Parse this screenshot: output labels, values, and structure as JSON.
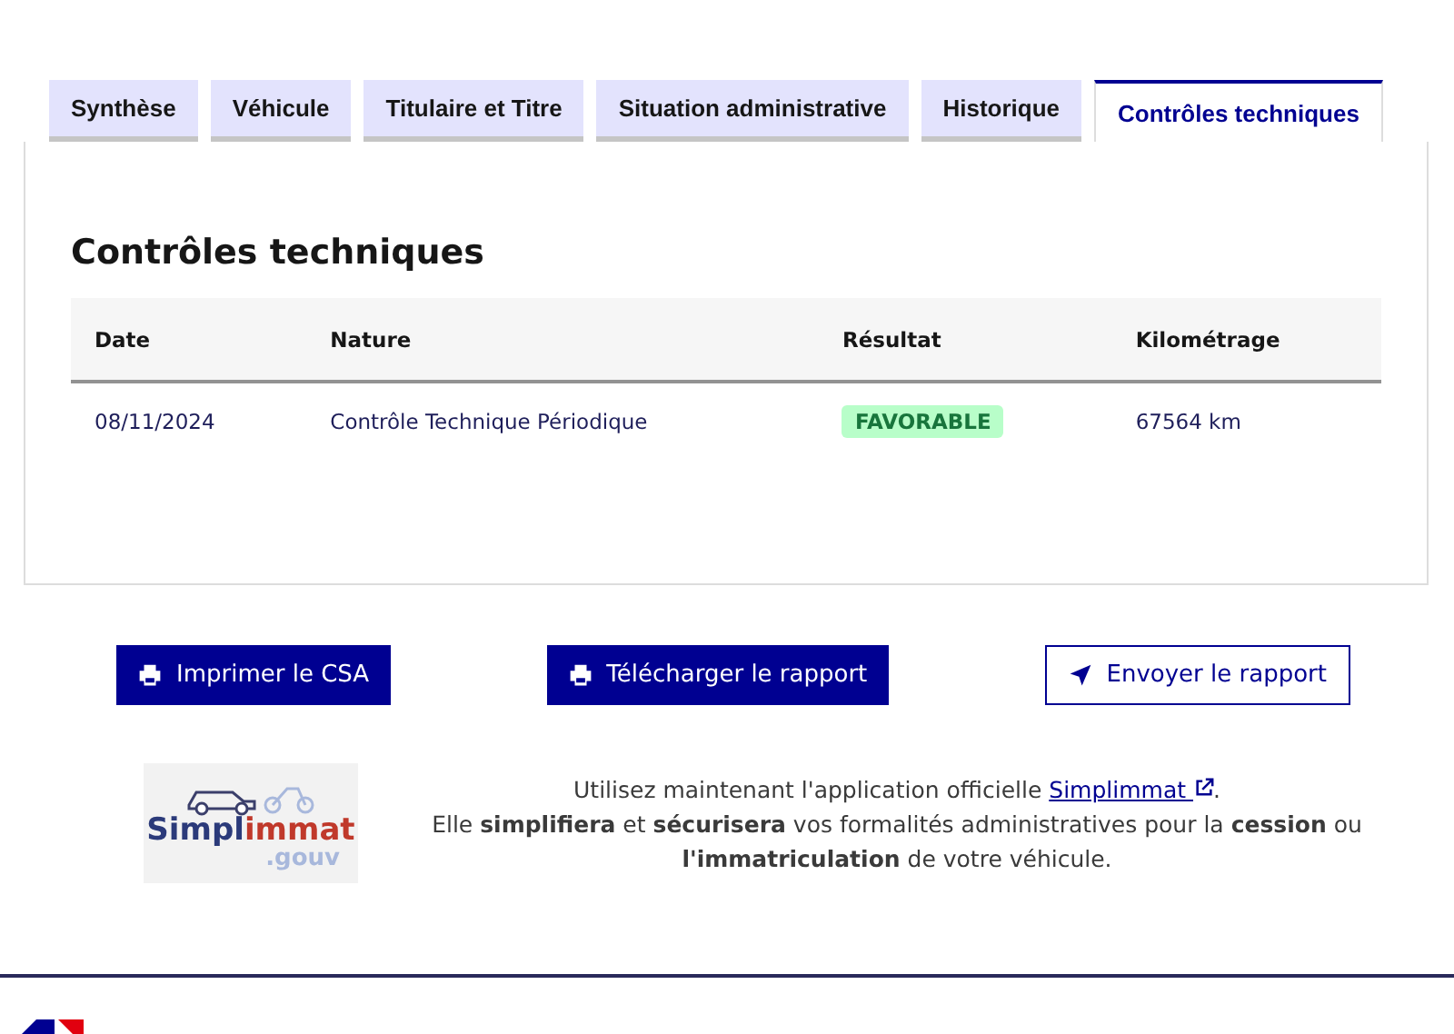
{
  "tabs": [
    {
      "label": "Synthèse",
      "selected": false
    },
    {
      "label": "Véhicule",
      "selected": false
    },
    {
      "label": "Titulaire et Titre",
      "selected": false
    },
    {
      "label": "Situation administrative",
      "selected": false
    },
    {
      "label": "Historique",
      "selected": false
    },
    {
      "label": "Contrôles techniques",
      "selected": true
    }
  ],
  "panel": {
    "title": "Contrôles techniques",
    "table": {
      "columns": [
        "Date",
        "Nature",
        "Résultat",
        "Kilométrage"
      ],
      "rows": [
        {
          "date": "08/11/2024",
          "nature": "Contrôle Technique Périodique",
          "result": "FAVORABLE",
          "mileage": "67564 km"
        }
      ]
    }
  },
  "buttons": [
    {
      "label": "Imprimer le CSA",
      "kind": "print",
      "primary": true
    },
    {
      "label": "Télécharger le rapport",
      "kind": "print",
      "primary": true
    },
    {
      "label": "Envoyer le rapport",
      "kind": "send",
      "primary": false
    }
  ],
  "promo": {
    "logo": {
      "part_1": "Simpl",
      "part_2": "immat",
      "part_3": ".gouv"
    },
    "line_1": "Utilisez maintenant l'application officielle ",
    "link": "Simplimmat",
    "line_1_end": ".",
    "line_2": "Elle **simplifiera** et **sécurisera** vos formalités administratives pour la **cession** ou **l'immatriculation** de votre véhicule."
  }
}
